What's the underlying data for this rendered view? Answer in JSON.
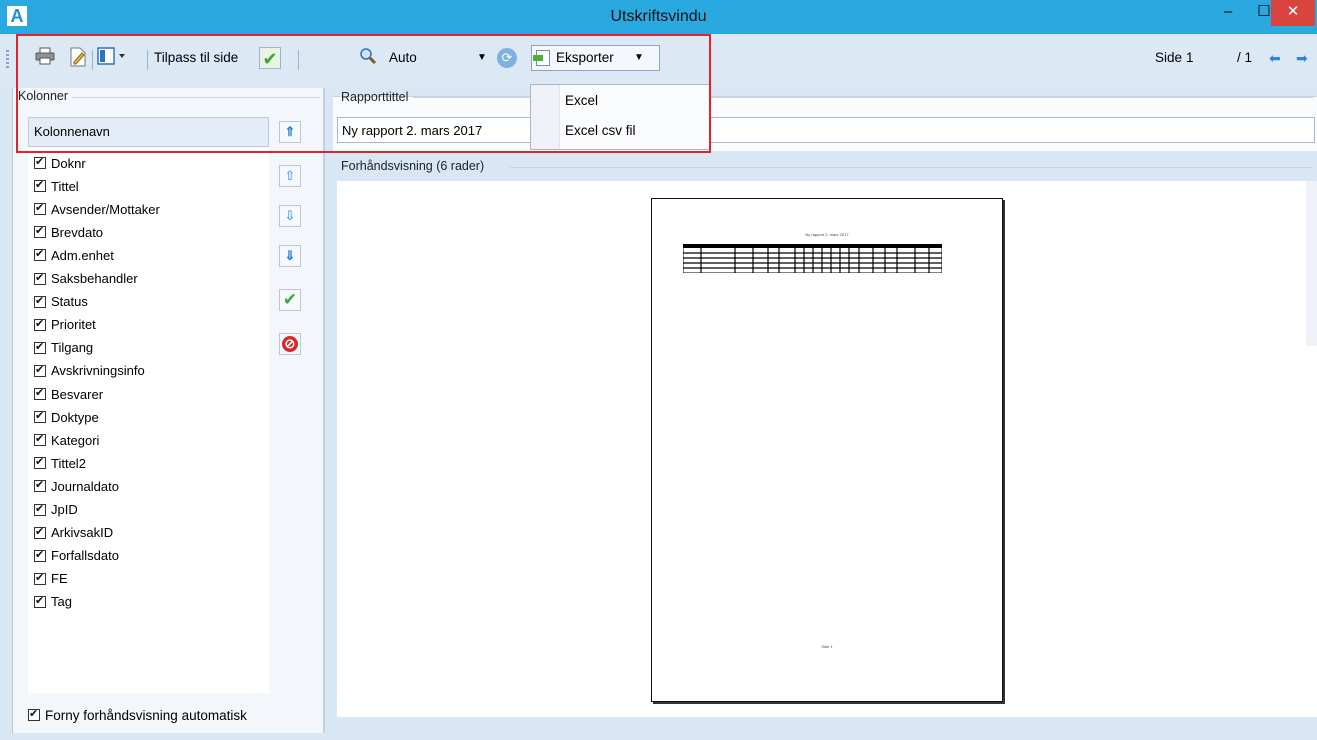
{
  "window": {
    "title": "Utskriftsvindu",
    "app_icon": "A",
    "minimize": "–",
    "maximize": "☐",
    "close": "✕"
  },
  "toolbar": {
    "fit_label": "Tilpass til side",
    "zoom_value": "Auto",
    "export_label": "Eksporter",
    "page_label": "Side",
    "page_value": "1",
    "page_total": "/ 1",
    "icons": [
      "print-icon",
      "page-setup-icon",
      "layout-icon",
      "search-icon",
      "refresh-icon",
      "export-icon",
      "arrow-left-icon",
      "arrow-right-icon"
    ]
  },
  "export_menu": {
    "items": [
      "Excel",
      "Excel csv fil"
    ]
  },
  "columns_panel": {
    "title": "Kolonner",
    "header": "Kolonnenavn",
    "items": [
      {
        "label": "Doknr",
        "checked": true
      },
      {
        "label": "Tittel",
        "checked": true
      },
      {
        "label": "Avsender/Mottaker",
        "checked": true
      },
      {
        "label": "Brevdato",
        "checked": true
      },
      {
        "label": "Adm.enhet",
        "checked": true
      },
      {
        "label": "Saksbehandler",
        "checked": true
      },
      {
        "label": "Status",
        "checked": true
      },
      {
        "label": "Prioritet",
        "checked": true
      },
      {
        "label": "Tilgang",
        "checked": true
      },
      {
        "label": "Avskrivningsinfo",
        "checked": true
      },
      {
        "label": "Besvarer",
        "checked": true
      },
      {
        "label": "Doktype",
        "checked": true
      },
      {
        "label": "Kategori",
        "checked": true
      },
      {
        "label": "Tittel2",
        "checked": true
      },
      {
        "label": "Journaldato",
        "checked": true
      },
      {
        "label": "JpID",
        "checked": true
      },
      {
        "label": "ArkivsakID",
        "checked": true
      },
      {
        "label": "Forfallsdato",
        "checked": true
      },
      {
        "label": "FE",
        "checked": true
      },
      {
        "label": "Tag",
        "checked": true
      }
    ],
    "auto_refresh_label": "Forny forhåndsvisning automatisk"
  },
  "report": {
    "title_label": "Rapporttittel",
    "title_value": "Ny rapport 2. mars 2017"
  },
  "preview": {
    "title": "Forhåndsvisning (6 rader)",
    "page_heading": "Ny rapport 2. mars 2017",
    "page_footer": "Side 1"
  },
  "colors": {
    "titlebar": "#29a9e0",
    "close": "#d9453e",
    "highlight": "#e2242a"
  }
}
